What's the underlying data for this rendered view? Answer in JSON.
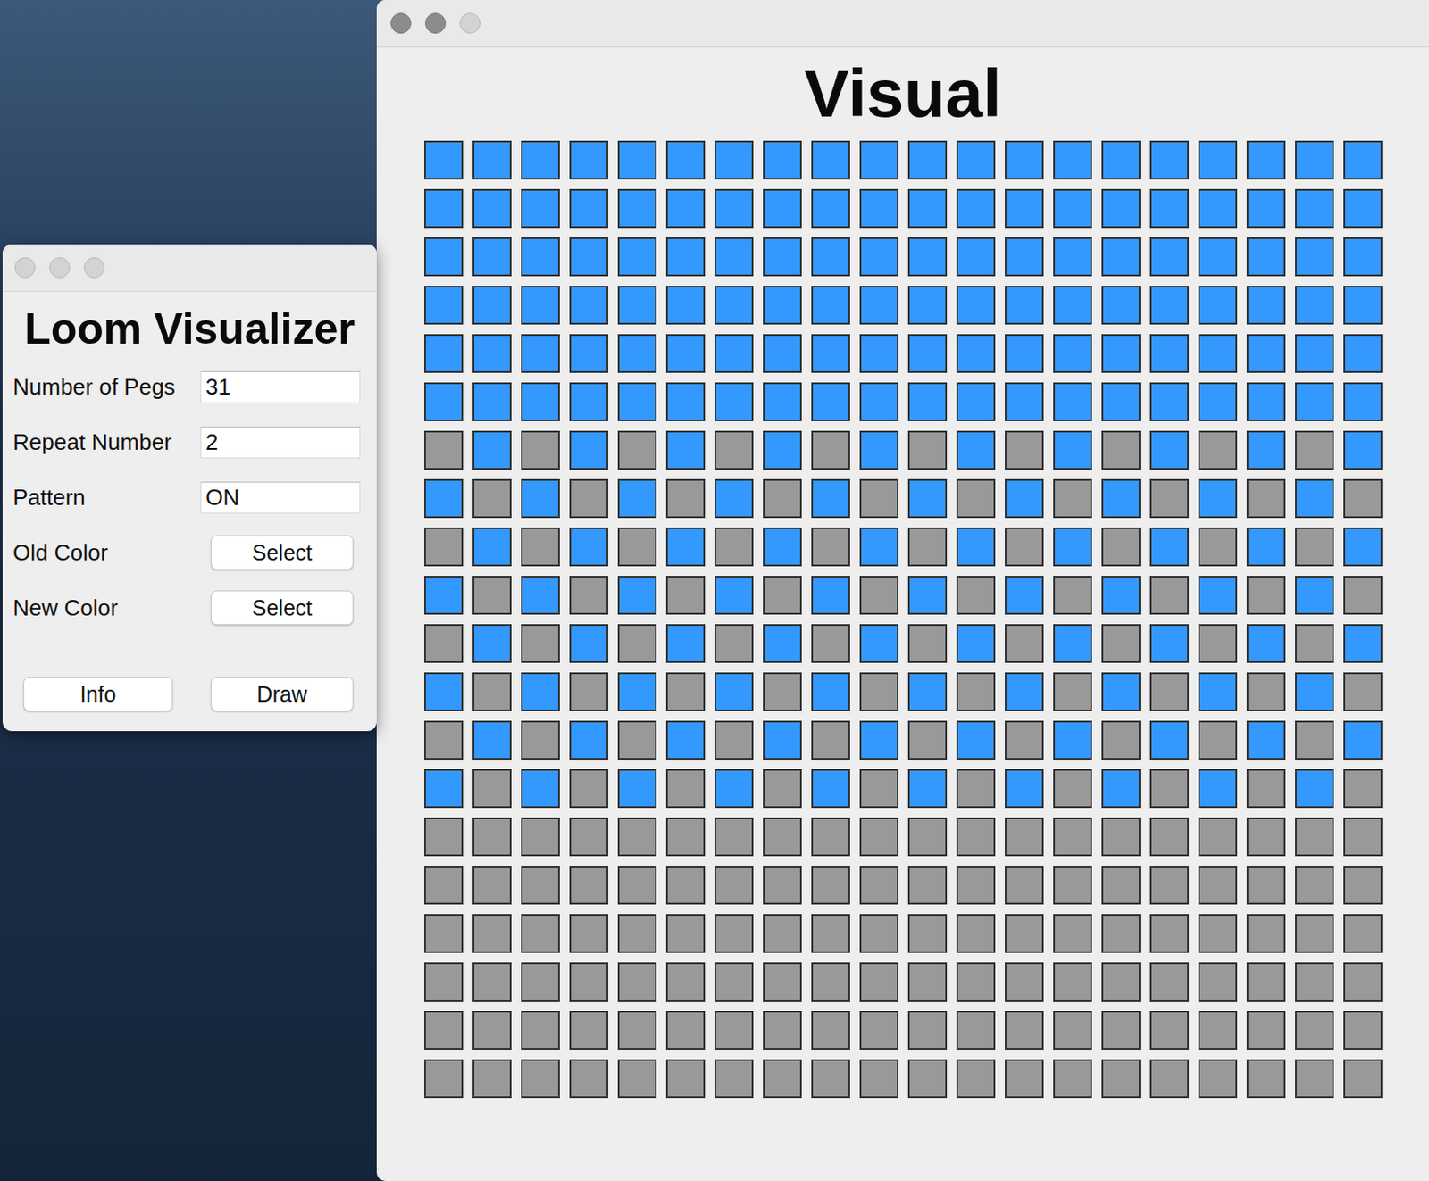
{
  "visual_window": {
    "title": "Visual",
    "window_buttons": [
      {
        "enabled": true
      },
      {
        "enabled": true
      },
      {
        "enabled": false
      }
    ],
    "grid": [
      [
        "#3399ff",
        "#3399ff",
        "#3399ff",
        "#3399ff",
        "#3399ff",
        "#3399ff",
        "#3399ff",
        "#3399ff",
        "#3399ff",
        "#3399ff",
        "#3399ff",
        "#3399ff",
        "#3399ff",
        "#3399ff",
        "#3399ff",
        "#3399ff",
        "#3399ff",
        "#3399ff",
        "#3399ff",
        "#3399ff"
      ],
      [
        "#3399ff",
        "#3399ff",
        "#3399ff",
        "#3399ff",
        "#3399ff",
        "#3399ff",
        "#3399ff",
        "#3399ff",
        "#3399ff",
        "#3399ff",
        "#3399ff",
        "#3399ff",
        "#3399ff",
        "#3399ff",
        "#3399ff",
        "#3399ff",
        "#3399ff",
        "#3399ff",
        "#3399ff",
        "#3399ff"
      ],
      [
        "#3399ff",
        "#3399ff",
        "#3399ff",
        "#3399ff",
        "#3399ff",
        "#3399ff",
        "#3399ff",
        "#3399ff",
        "#3399ff",
        "#3399ff",
        "#3399ff",
        "#3399ff",
        "#3399ff",
        "#3399ff",
        "#3399ff",
        "#3399ff",
        "#3399ff",
        "#3399ff",
        "#3399ff",
        "#3399ff"
      ],
      [
        "#3399ff",
        "#3399ff",
        "#3399ff",
        "#3399ff",
        "#3399ff",
        "#3399ff",
        "#3399ff",
        "#3399ff",
        "#3399ff",
        "#3399ff",
        "#3399ff",
        "#3399ff",
        "#3399ff",
        "#3399ff",
        "#3399ff",
        "#3399ff",
        "#3399ff",
        "#3399ff",
        "#3399ff",
        "#3399ff"
      ],
      [
        "#3399ff",
        "#3399ff",
        "#3399ff",
        "#3399ff",
        "#3399ff",
        "#3399ff",
        "#3399ff",
        "#3399ff",
        "#3399ff",
        "#3399ff",
        "#3399ff",
        "#3399ff",
        "#3399ff",
        "#3399ff",
        "#3399ff",
        "#3399ff",
        "#3399ff",
        "#3399ff",
        "#3399ff",
        "#3399ff"
      ],
      [
        "#3399ff",
        "#3399ff",
        "#3399ff",
        "#3399ff",
        "#3399ff",
        "#3399ff",
        "#3399ff",
        "#3399ff",
        "#3399ff",
        "#3399ff",
        "#3399ff",
        "#3399ff",
        "#3399ff",
        "#3399ff",
        "#3399ff",
        "#3399ff",
        "#3399ff",
        "#3399ff",
        "#3399ff",
        "#3399ff"
      ],
      [
        "#999999",
        "#3399ff",
        "#999999",
        "#3399ff",
        "#999999",
        "#3399ff",
        "#999999",
        "#3399ff",
        "#999999",
        "#3399ff",
        "#999999",
        "#3399ff",
        "#999999",
        "#3399ff",
        "#999999",
        "#3399ff",
        "#999999",
        "#3399ff",
        "#999999",
        "#3399ff"
      ],
      [
        "#3399ff",
        "#999999",
        "#3399ff",
        "#999999",
        "#3399ff",
        "#999999",
        "#3399ff",
        "#999999",
        "#3399ff",
        "#999999",
        "#3399ff",
        "#999999",
        "#3399ff",
        "#999999",
        "#3399ff",
        "#999999",
        "#3399ff",
        "#999999",
        "#3399ff",
        "#999999"
      ],
      [
        "#999999",
        "#3399ff",
        "#999999",
        "#3399ff",
        "#999999",
        "#3399ff",
        "#999999",
        "#3399ff",
        "#999999",
        "#3399ff",
        "#999999",
        "#3399ff",
        "#999999",
        "#3399ff",
        "#999999",
        "#3399ff",
        "#999999",
        "#3399ff",
        "#999999",
        "#3399ff"
      ],
      [
        "#3399ff",
        "#999999",
        "#3399ff",
        "#999999",
        "#3399ff",
        "#999999",
        "#3399ff",
        "#999999",
        "#3399ff",
        "#999999",
        "#3399ff",
        "#999999",
        "#3399ff",
        "#999999",
        "#3399ff",
        "#999999",
        "#3399ff",
        "#999999",
        "#3399ff",
        "#999999"
      ],
      [
        "#999999",
        "#3399ff",
        "#999999",
        "#3399ff",
        "#999999",
        "#3399ff",
        "#999999",
        "#3399ff",
        "#999999",
        "#3399ff",
        "#999999",
        "#3399ff",
        "#999999",
        "#3399ff",
        "#999999",
        "#3399ff",
        "#999999",
        "#3399ff",
        "#999999",
        "#3399ff"
      ],
      [
        "#3399ff",
        "#999999",
        "#3399ff",
        "#999999",
        "#3399ff",
        "#999999",
        "#3399ff",
        "#999999",
        "#3399ff",
        "#999999",
        "#3399ff",
        "#999999",
        "#3399ff",
        "#999999",
        "#3399ff",
        "#999999",
        "#3399ff",
        "#999999",
        "#3399ff",
        "#999999"
      ],
      [
        "#999999",
        "#3399ff",
        "#999999",
        "#3399ff",
        "#999999",
        "#3399ff",
        "#999999",
        "#3399ff",
        "#999999",
        "#3399ff",
        "#999999",
        "#3399ff",
        "#999999",
        "#3399ff",
        "#999999",
        "#3399ff",
        "#999999",
        "#3399ff",
        "#999999",
        "#3399ff"
      ],
      [
        "#3399ff",
        "#999999",
        "#3399ff",
        "#999999",
        "#3399ff",
        "#999999",
        "#3399ff",
        "#999999",
        "#3399ff",
        "#999999",
        "#3399ff",
        "#999999",
        "#3399ff",
        "#999999",
        "#3399ff",
        "#999999",
        "#3399ff",
        "#999999",
        "#3399ff",
        "#999999"
      ],
      [
        "#999999",
        "#999999",
        "#999999",
        "#999999",
        "#999999",
        "#999999",
        "#999999",
        "#999999",
        "#999999",
        "#999999",
        "#999999",
        "#999999",
        "#999999",
        "#999999",
        "#999999",
        "#999999",
        "#999999",
        "#999999",
        "#999999",
        "#999999"
      ],
      [
        "#999999",
        "#999999",
        "#999999",
        "#999999",
        "#999999",
        "#999999",
        "#999999",
        "#999999",
        "#999999",
        "#999999",
        "#999999",
        "#999999",
        "#999999",
        "#999999",
        "#999999",
        "#999999",
        "#999999",
        "#999999",
        "#999999",
        "#999999"
      ],
      [
        "#999999",
        "#999999",
        "#999999",
        "#999999",
        "#999999",
        "#999999",
        "#999999",
        "#999999",
        "#999999",
        "#999999",
        "#999999",
        "#999999",
        "#999999",
        "#999999",
        "#999999",
        "#999999",
        "#999999",
        "#999999",
        "#999999",
        "#999999"
      ],
      [
        "#999999",
        "#999999",
        "#999999",
        "#999999",
        "#999999",
        "#999999",
        "#999999",
        "#999999",
        "#999999",
        "#999999",
        "#999999",
        "#999999",
        "#999999",
        "#999999",
        "#999999",
        "#999999",
        "#999999",
        "#999999",
        "#999999",
        "#999999"
      ],
      [
        "#999999",
        "#999999",
        "#999999",
        "#999999",
        "#999999",
        "#999999",
        "#999999",
        "#999999",
        "#999999",
        "#999999",
        "#999999",
        "#999999",
        "#999999",
        "#999999",
        "#999999",
        "#999999",
        "#999999",
        "#999999",
        "#999999",
        "#999999"
      ],
      [
        "#999999",
        "#999999",
        "#999999",
        "#999999",
        "#999999",
        "#999999",
        "#999999",
        "#999999",
        "#999999",
        "#999999",
        "#999999",
        "#999999",
        "#999999",
        "#999999",
        "#999999",
        "#999999",
        "#999999",
        "#999999",
        "#999999",
        "#999999"
      ]
    ]
  },
  "control_window": {
    "title": "Loom Visualizer",
    "window_buttons": [
      {
        "enabled": false
      },
      {
        "enabled": false
      },
      {
        "enabled": false
      }
    ],
    "fields": [
      {
        "label": "Number of Pegs",
        "kind": "text",
        "value": "31"
      },
      {
        "label": "Repeat Number",
        "kind": "text",
        "value": "2"
      },
      {
        "label": "Pattern",
        "kind": "text",
        "value": "ON"
      },
      {
        "label": "Old Color",
        "kind": "button",
        "value": "Select"
      },
      {
        "label": "New Color",
        "kind": "button",
        "value": "Select"
      }
    ],
    "buttons": [
      "Info",
      "Draw"
    ]
  }
}
